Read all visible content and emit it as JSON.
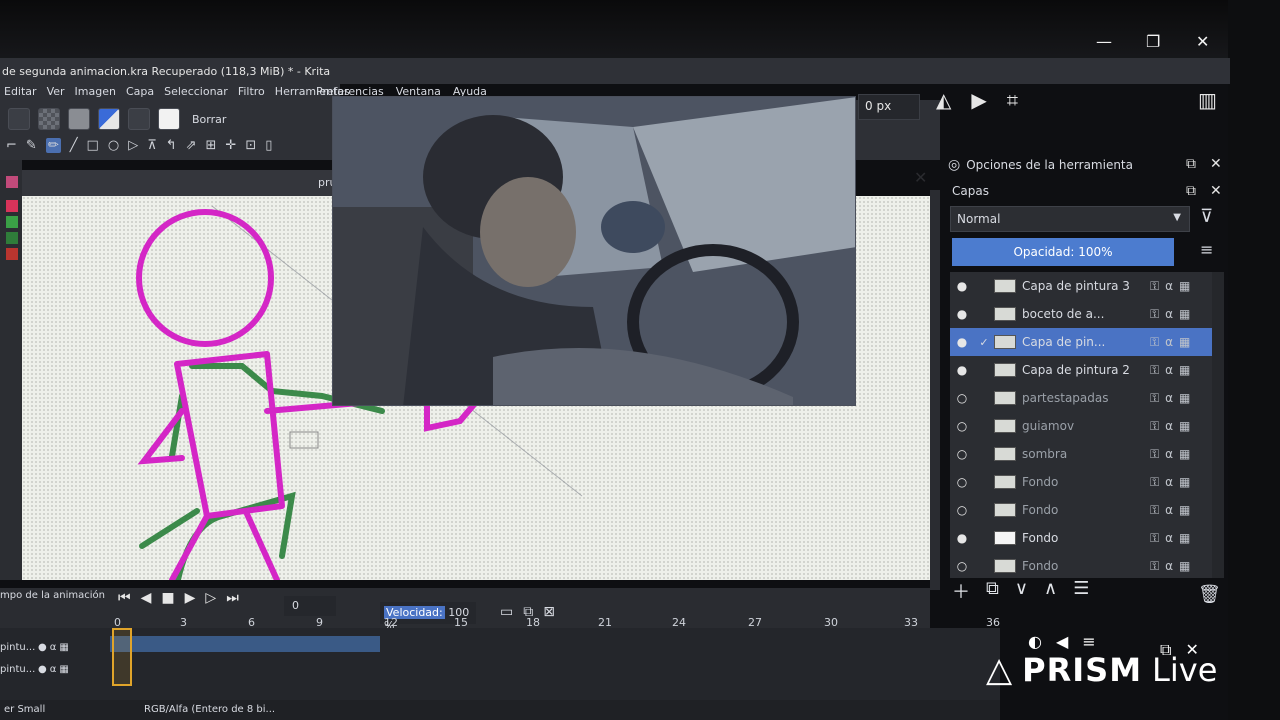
{
  "window": {
    "title": "de segunda animacion.kra Recuperado (118,3 MiB) * - Krita",
    "minimize": "—",
    "maximize": "❐",
    "close": "✕"
  },
  "menu": {
    "items": [
      "Editar",
      "Ver",
      "Imagen",
      "Capa",
      "Seleccionar",
      "Filtro",
      "Herramientas",
      "Preferencias",
      "Ventana",
      "Ayuda"
    ]
  },
  "toolbar": {
    "erase_label": "Borrar",
    "size_value": "0 px",
    "tools": [
      "⌐",
      "✎",
      "✏",
      "╱",
      "□",
      "○",
      "▷",
      "⊼",
      "↰",
      "⇗",
      "⊞",
      "✛",
      "⊡",
      "▯"
    ]
  },
  "canvas_tab": {
    "name": "pru"
  },
  "tool_options": {
    "title": "Opciones de la herramienta"
  },
  "layers_docker": {
    "title": "Capas",
    "blend_mode": "Normal",
    "opacity": "Opacidad:  100%",
    "layers": [
      {
        "name": "Capa de pintura 3",
        "visible": true,
        "selected": false,
        "checked": false
      },
      {
        "name": "boceto de a...",
        "visible": true,
        "selected": false,
        "checked": false
      },
      {
        "name": "Capa de pin...",
        "visible": true,
        "selected": true,
        "checked": true
      },
      {
        "name": "Capa de pintura 2",
        "visible": true,
        "selected": false,
        "checked": false
      },
      {
        "name": "partestapadas",
        "visible": false,
        "selected": false,
        "checked": false
      },
      {
        "name": "guiamov",
        "visible": false,
        "selected": false,
        "checked": false
      },
      {
        "name": "sombra",
        "visible": false,
        "selected": false,
        "checked": false
      },
      {
        "name": "Fondo",
        "visible": false,
        "selected": false,
        "checked": false
      },
      {
        "name": "Fondo",
        "visible": false,
        "selected": false,
        "checked": false
      },
      {
        "name": "Fondo",
        "visible": true,
        "selected": false,
        "checked": false
      },
      {
        "name": "Fondo",
        "visible": false,
        "selected": false,
        "checked": false
      }
    ]
  },
  "animation": {
    "label": "mpo de la animación",
    "frame": "0",
    "speed_label": "Velocidad:",
    "speed_value": "100 %",
    "ruler": [
      "0",
      "3",
      "6",
      "9",
      "12",
      "15",
      "18",
      "21",
      "24",
      "27",
      "30",
      "33",
      "36"
    ],
    "tracks": [
      {
        "name": "pintu..."
      },
      {
        "name": "pintu..."
      }
    ]
  },
  "status": {
    "left": "er Small",
    "mid": "RGB/Alfa (Entero de 8 bi..."
  },
  "watermark": {
    "brand": "PRISM",
    "suffix": "Live"
  }
}
